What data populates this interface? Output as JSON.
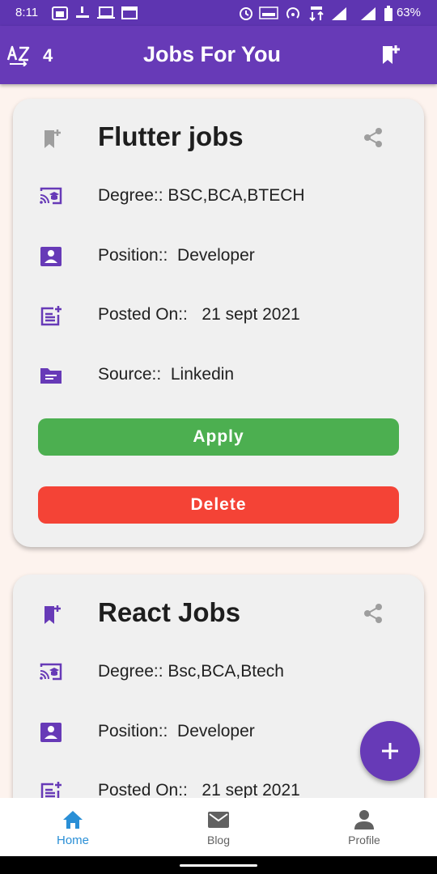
{
  "status_bar": {
    "time": "8:11",
    "battery": "63%"
  },
  "app_bar": {
    "sort_icon": "sort-az-icon",
    "count": "4",
    "title": "Jobs For You",
    "action_icon": "bookmark-add-icon"
  },
  "jobs": [
    {
      "title": "Flutter jobs",
      "degree": "Degree:: BSC,BCA,BTECH",
      "position": "Position::  Developer",
      "posted_on": "Posted On::   21 sept 2021",
      "source": "Source::  Linkedin",
      "bookmarked": false,
      "apply_label": "Apply",
      "delete_label": "Delete"
    },
    {
      "title": "React Jobs",
      "degree": "Degree:: Bsc,BCA,Btech",
      "position": "Position::  Developer",
      "posted_on": "Posted On::   21 sept 2021",
      "bookmarked": true
    }
  ],
  "colors": {
    "primary": "#673ab7",
    "status_bar": "#5e35b1",
    "apply": "#4caf50",
    "delete": "#f44336",
    "nav_active": "#2a8fd6",
    "background": "#fdf3ee",
    "card": "#f0f0f0"
  },
  "fab": {
    "icon": "plus-icon"
  },
  "bottom_nav": [
    {
      "label": "Home",
      "icon": "home-icon",
      "active": true
    },
    {
      "label": "Blog",
      "icon": "mail-icon",
      "active": false
    },
    {
      "label": "Profile",
      "icon": "person-icon",
      "active": false
    }
  ]
}
